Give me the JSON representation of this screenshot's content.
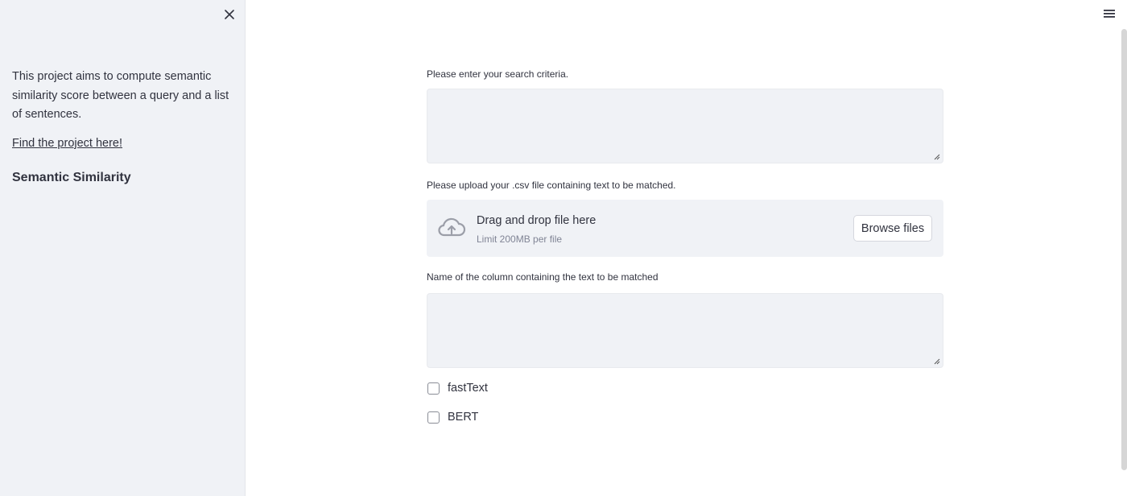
{
  "sidebar": {
    "description": "This project aims to compute semantic similarity score between a query and a list of sentences.",
    "link_text": "Find the project here!",
    "heading": "Semantic Similarity"
  },
  "main": {
    "search": {
      "label": "Please enter your search criteria.",
      "value": ""
    },
    "upload": {
      "label": "Please upload your .csv file containing text to be matched.",
      "dropzone_title": "Drag and drop file here",
      "dropzone_limit": "Limit 200MB per file",
      "browse_label": "Browse files"
    },
    "column": {
      "label": "Name of the column containing the text to be matched",
      "value": ""
    },
    "checkboxes": [
      {
        "label": "fastText",
        "checked": false
      },
      {
        "label": "BERT",
        "checked": false
      }
    ]
  },
  "icons": {
    "close": "close-icon",
    "menu": "hamburger-menu-icon",
    "upload": "cloud-upload-icon"
  }
}
